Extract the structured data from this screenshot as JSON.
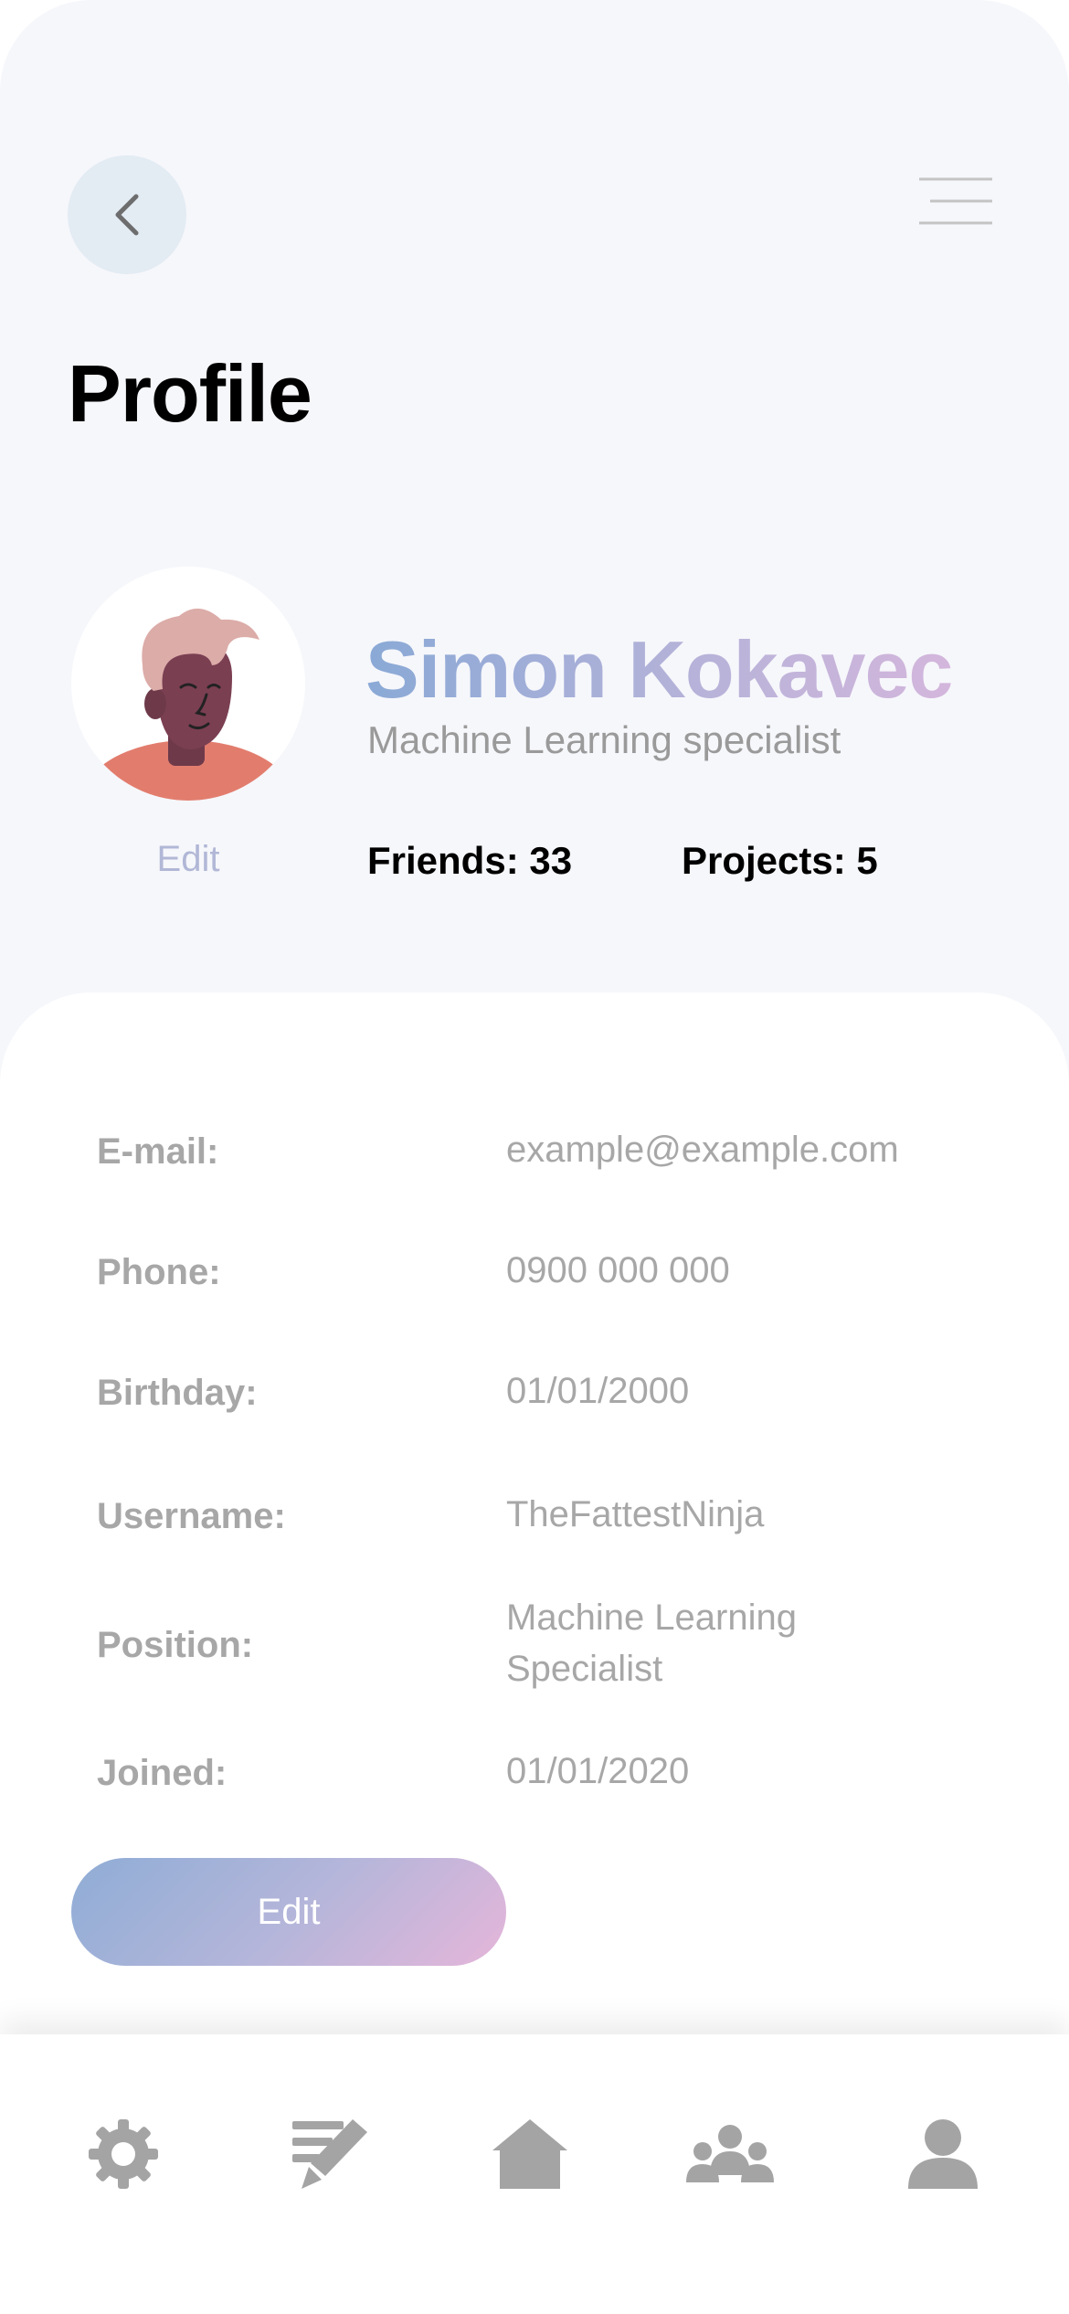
{
  "header": {
    "title": "Profile",
    "back_icon": "chevron-left-icon",
    "menu_icon": "hamburger-menu-icon"
  },
  "profile": {
    "name": "Simon Kokavec",
    "role": "Machine Learning specialist",
    "avatar_edit_label": "Edit",
    "friends_label": "Friends: 33",
    "projects_label": "Projects: 5"
  },
  "details": [
    {
      "label": "E-mail:",
      "value": "example@example.com"
    },
    {
      "label": "Phone:",
      "value": "0900 000 000"
    },
    {
      "label": "Birthday:",
      "value": "01/01/2000"
    },
    {
      "label": "Username:",
      "value": "TheFattestNinja"
    },
    {
      "label": "Position:",
      "value": "Machine Learning Specialist"
    },
    {
      "label": "Joined:",
      "value": "01/01/2020"
    }
  ],
  "edit_button_label": "Edit",
  "nav": {
    "items": [
      "settings-gear-icon",
      "edit-notes-icon",
      "home-icon",
      "group-icon",
      "profile-person-icon"
    ],
    "active": "profile-person-icon"
  },
  "colors": {
    "background": "#f6f7fb",
    "name_gradient_start": "#8aa9d6",
    "name_gradient_end": "#d4b6dc",
    "button_gradient_start": "#8fadd6",
    "button_gradient_end": "#e5b6da",
    "icon_gray": "#a4a4a4",
    "text_gray": "#a7a7a7"
  }
}
